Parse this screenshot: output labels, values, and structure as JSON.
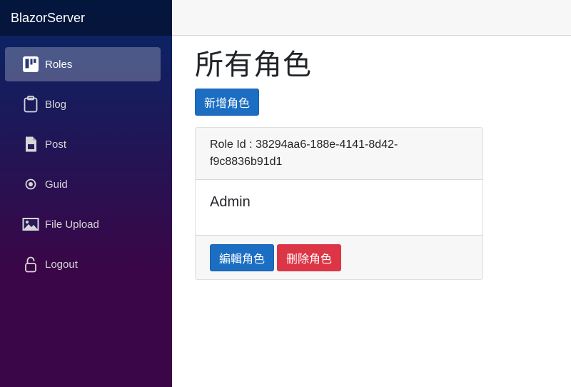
{
  "sidebar": {
    "brand": "BlazorServer",
    "items": [
      {
        "label": "Roles",
        "icon": "trello-board-icon",
        "active": true
      },
      {
        "label": "Blog",
        "icon": "clipboard-icon"
      },
      {
        "label": "Post",
        "icon": "document-icon"
      },
      {
        "label": "Guid",
        "icon": "radio-dot-icon"
      },
      {
        "label": "File Upload",
        "icon": "image-icon"
      },
      {
        "label": "Logout",
        "icon": "lock-icon"
      }
    ]
  },
  "main": {
    "title": "所有角色",
    "add_button": "新增角色",
    "role_card": {
      "id_line1": "Role Id : 38294aa6-188e-4141-8d42-",
      "id_line2": "f9c8836b91d1",
      "name": "Admin",
      "edit_button": "編輯角色",
      "delete_button": "刪除角色"
    }
  },
  "colors": {
    "primary": "#1b6ec2",
    "danger": "#dc3545",
    "sidebar_top": "#052767",
    "sidebar_bottom": "#3a0647"
  }
}
